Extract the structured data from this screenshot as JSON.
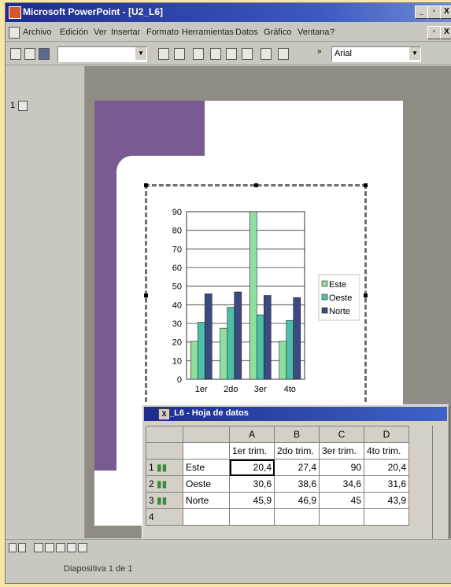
{
  "window": {
    "title": "Microsoft PowerPoint - [U2_L6]",
    "minimize": "_",
    "restore": "▫",
    "close": "X"
  },
  "menu": [
    "Archivo",
    "Edición",
    "Ver",
    "Insertar",
    "Formato",
    "Herramientas",
    "Datos",
    "Gráfico",
    "Ventana",
    "?"
  ],
  "toolbar": {
    "font": "Arial",
    "more": "»"
  },
  "outline": {
    "slide_number": "1"
  },
  "status": {
    "slide_info": "Diapositiva 1 de 1"
  },
  "chart_data": {
    "type": "bar",
    "categories": [
      "1er",
      "2do",
      "3er",
      "4to"
    ],
    "series": [
      {
        "name": "Este",
        "values": [
          20.4,
          27.4,
          90,
          20.4
        ],
        "color": "#8fe0a0"
      },
      {
        "name": "Oeste",
        "values": [
          30.6,
          38.6,
          34.6,
          31.6
        ],
        "color": "#4cc0a8"
      },
      {
        "name": "Norte",
        "values": [
          45.9,
          46.9,
          45,
          43.9
        ],
        "color": "#3c4a82"
      }
    ],
    "yticks": [
      0,
      10,
      20,
      30,
      40,
      50,
      60,
      70,
      80,
      90
    ],
    "ylim": [
      0,
      90
    ],
    "legend": "right",
    "grid": true
  },
  "datasheet": {
    "title": "U2_L6 - Hoja de datos",
    "columns": [
      "A",
      "B",
      "C",
      "D"
    ],
    "headers": [
      "1er trim.",
      "2do trim.",
      "3er trim.",
      "4to trim."
    ],
    "rows": [
      {
        "num": "1",
        "name": "Este",
        "values": [
          "20,4",
          "27,4",
          "90",
          "20,4"
        ]
      },
      {
        "num": "2",
        "name": "Oeste",
        "values": [
          "30,6",
          "38,6",
          "34,6",
          "31,6"
        ]
      },
      {
        "num": "3",
        "name": "Norte",
        "values": [
          "45,9",
          "46,9",
          "45",
          "43,9"
        ]
      },
      {
        "num": "4",
        "name": "",
        "values": [
          "",
          "",
          "",
          ""
        ]
      }
    ]
  }
}
